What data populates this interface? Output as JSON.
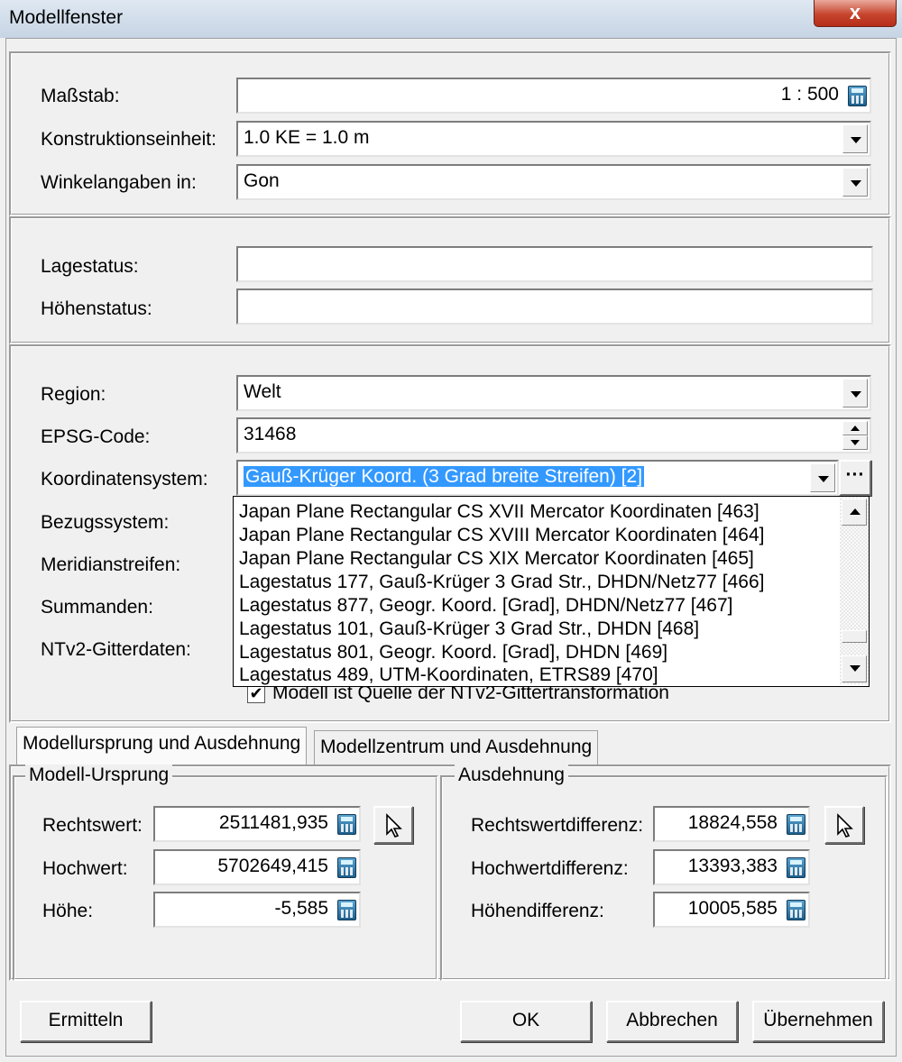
{
  "window": {
    "title": "Modellfenster",
    "close_label": "x"
  },
  "general": {
    "scale_label": "Maßstab:",
    "scale_value": "1 : 500",
    "unit_label": "Konstruktionseinheit:",
    "unit_value": "1.0 KE  =  1.0 m",
    "angle_label": "Winkelangaben in:",
    "angle_value": "Gon"
  },
  "status": {
    "position_label": "Lagestatus:",
    "position_value": "",
    "height_label": "Höhenstatus:",
    "height_value": ""
  },
  "crs": {
    "region_label": "Region:",
    "region_value": "Welt",
    "epsg_label": "EPSG-Code:",
    "epsg_value": "31468",
    "system_label": "Koordinatensystem:",
    "system_value": "Gauß-Krüger Koord. (3 Grad breite Streifen) [2]",
    "more_label": "···",
    "datum_label": "Bezugssystem:",
    "meridian_label": "Meridianstreifen:",
    "summands_label": "Summanden:",
    "ntv2_label": "NTv2-Gitterdaten:",
    "ntv2_checkbox_label": "Modell ist Quelle der NTv2-Gittertransformation",
    "ntv2_checked": true,
    "dropdown_items": [
      "Japan Plane Rectangular CS XVII Mercator Koordinaten [463]",
      "Japan Plane Rectangular CS XVIII Mercator Koordinaten [464]",
      "Japan Plane Rectangular CS XIX Mercator Koordinaten [465]",
      "Lagestatus 177, Gauß-Krüger 3 Grad Str., DHDN/Netz77 [466]",
      "Lagestatus 877, Geogr. Koord. [Grad], DHDN/Netz77 [467]",
      "Lagestatus 101, Gauß-Krüger 3 Grad Str., DHDN [468]",
      "Lagestatus 801, Geogr. Koord. [Grad], DHDN [469]",
      "Lagestatus 489, UTM-Koordinaten, ETRS89 [470]"
    ]
  },
  "tabs": [
    {
      "label": "Modellursprung und Ausdehnung",
      "active": true
    },
    {
      "label": "Modellzentrum und Ausdehnung",
      "active": false
    }
  ],
  "origin": {
    "legend": "Modell-Ursprung",
    "east_label": "Rechtswert:",
    "east_value": "2511481,935",
    "north_label": "Hochwert:",
    "north_value": "5702649,415",
    "height_label": "Höhe:",
    "height_value": "-5,585"
  },
  "extent": {
    "legend": "Ausdehnung",
    "east_label": "Rechtswertdifferenz:",
    "east_value": "18824,558",
    "north_label": "Hochwertdifferenz:",
    "north_value": "13393,383",
    "height_label": "Höhendifferenz:",
    "height_value": "10005,585"
  },
  "buttons": {
    "determine": "Ermitteln",
    "ok": "OK",
    "cancel": "Abbrechen",
    "apply": "Übernehmen"
  },
  "colors": {
    "selection": "#3399ff",
    "close_button": "#c7452e"
  }
}
